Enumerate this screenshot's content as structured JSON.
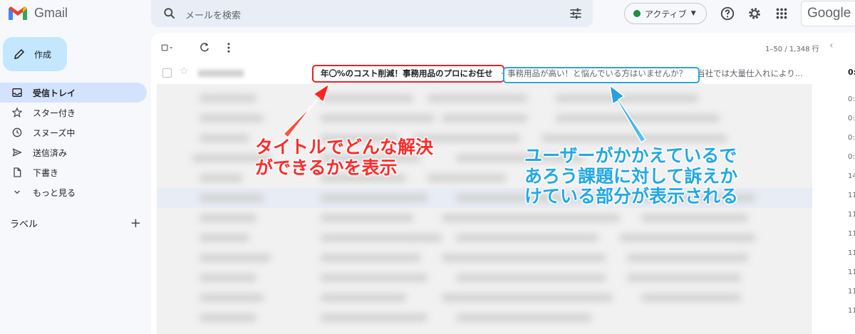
{
  "app": {
    "name": "Gmail",
    "brand": "Google"
  },
  "search": {
    "placeholder": "メールを検索"
  },
  "status": {
    "label": "アクティブ",
    "color": "#1e8e3e"
  },
  "compose": {
    "label": "作成"
  },
  "sidebar": {
    "items": [
      {
        "label": "受信トレイ",
        "icon": "inbox-icon",
        "active": true
      },
      {
        "label": "スター付き",
        "icon": "star-icon"
      },
      {
        "label": "スヌーズ中",
        "icon": "clock-icon"
      },
      {
        "label": "送信済み",
        "icon": "send-icon"
      },
      {
        "label": "下書き",
        "icon": "draft-icon"
      },
      {
        "label": "もっと見る",
        "icon": "chevron-down-icon"
      }
    ],
    "labels_heading": "ラベル",
    "labels_add": "+"
  },
  "toolbar": {
    "pagination": "1–50 / 1,348 行",
    "prev": "‹"
  },
  "email": {
    "subject": "年〇%のコスト削減！事務用品のプロにお任せ",
    "separator": "-",
    "snippet_highlight": "事務用品が高い！と悩んでいる方はいませんか？",
    "snippet_rest": "当社では大量仕入れにより...",
    "time": "0:"
  },
  "time_column": [
    "0:",
    "0:",
    "0:",
    "0:",
    "14",
    "11",
    "11",
    "11",
    "11",
    "11",
    "11",
    "11"
  ],
  "annotations": {
    "red_lines": [
      "タイトルでどんな解決",
      "ができるかを表示"
    ],
    "blue_lines": [
      "ユーザーがかかえているで",
      "あろう課題に対して訴えか",
      "けている部分が表示される"
    ],
    "red_color": "#ff2a2a",
    "blue_color": "#22a8e6"
  }
}
